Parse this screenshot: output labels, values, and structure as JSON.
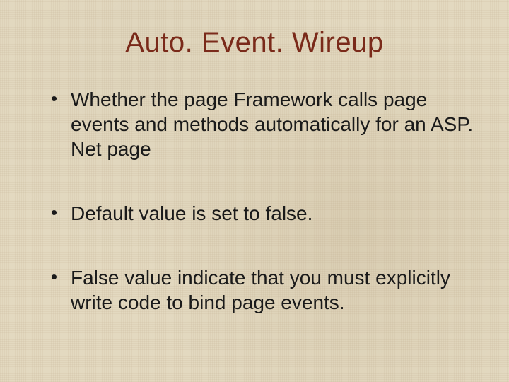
{
  "title": "Auto. Event. Wireup",
  "bullets": [
    "Whether the page Framework calls page events and methods automatically for an ASP. Net page",
    "Default value is set to false.",
    "False value indicate that you must explicitly write code to bind page events."
  ],
  "colors": {
    "title": "#7a2a1a",
    "background": "#e3d9c0",
    "text": "#1a1a1a"
  }
}
